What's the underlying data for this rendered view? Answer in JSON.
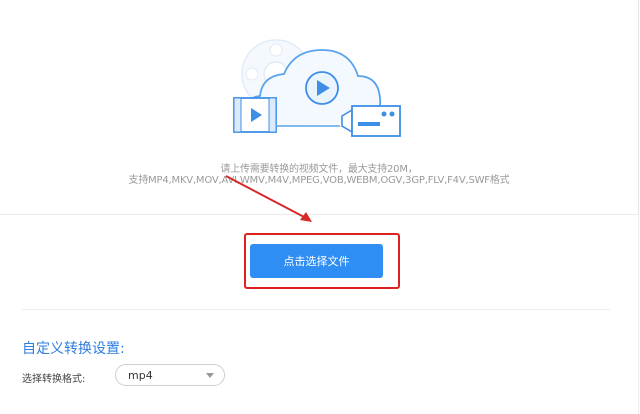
{
  "upload": {
    "hint_line1": "请上传需要转换的视频文件，最大支持20M，",
    "hint_line2": "支持MP4,MKV,MOV,AVI,WMV,M4V,MPEG,VOB,WEBM,OGV,3GP,FLV,F4V,SWF格式",
    "select_button_label": "点击选择文件"
  },
  "settings": {
    "title": "自定义转换设置:",
    "format_label": "选择转换格式:",
    "format_value": "mp4"
  },
  "colors": {
    "accent": "#2f8ef4",
    "annotation": "#e02020",
    "title": "#2f7de0"
  }
}
